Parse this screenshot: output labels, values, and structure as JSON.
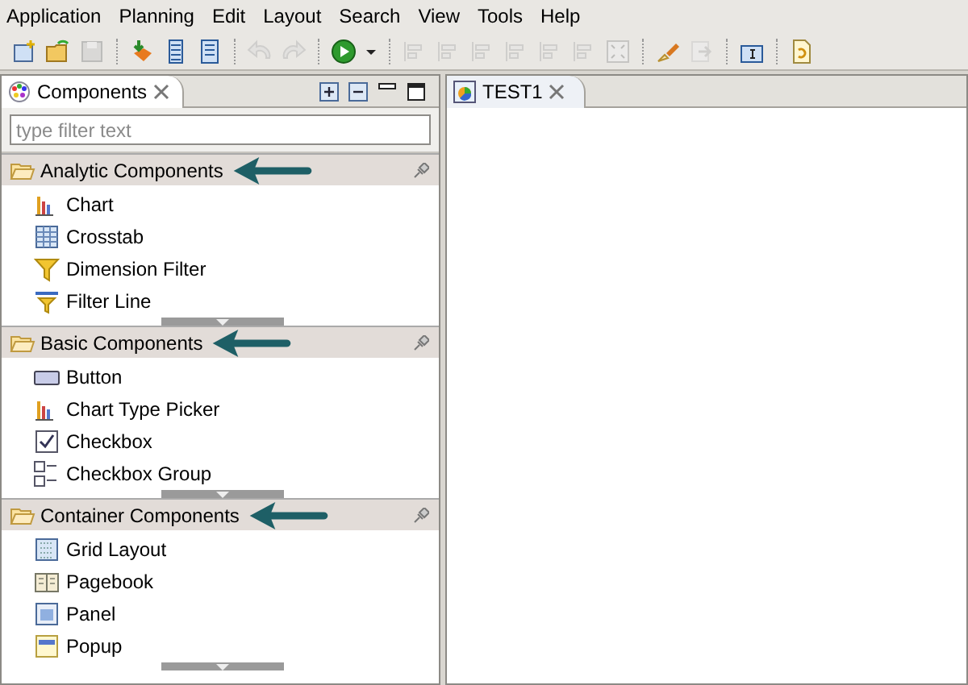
{
  "menu": [
    "Application",
    "Planning",
    "Edit",
    "Layout",
    "Search",
    "View",
    "Tools",
    "Help"
  ],
  "toolbar": [
    {
      "kind": "new",
      "disabled": false
    },
    {
      "kind": "open",
      "disabled": false
    },
    {
      "kind": "save",
      "disabled": true
    },
    {
      "kind": "sep"
    },
    {
      "kind": "import",
      "disabled": false
    },
    {
      "kind": "outline",
      "disabled": false
    },
    {
      "kind": "page",
      "disabled": false
    },
    {
      "kind": "sep"
    },
    {
      "kind": "undo",
      "disabled": true
    },
    {
      "kind": "redo",
      "disabled": true
    },
    {
      "kind": "sep"
    },
    {
      "kind": "run",
      "disabled": false
    },
    {
      "kind": "caret",
      "disabled": false
    },
    {
      "kind": "sep"
    },
    {
      "kind": "align",
      "disabled": true
    },
    {
      "kind": "align",
      "disabled": true
    },
    {
      "kind": "align",
      "disabled": true
    },
    {
      "kind": "align",
      "disabled": true
    },
    {
      "kind": "align",
      "disabled": true
    },
    {
      "kind": "align",
      "disabled": true
    },
    {
      "kind": "fit",
      "disabled": true
    },
    {
      "kind": "sep"
    },
    {
      "kind": "brush",
      "disabled": false
    },
    {
      "kind": "forward",
      "disabled": true
    },
    {
      "kind": "sep"
    },
    {
      "kind": "textfield",
      "disabled": false
    },
    {
      "kind": "sep"
    },
    {
      "kind": "script",
      "disabled": false
    }
  ],
  "components_view": {
    "title": "Components",
    "filter_placeholder": "type filter text",
    "sections": [
      {
        "title": "Analytic Components",
        "arrow": true,
        "items": [
          {
            "label": "Chart",
            "kind": "chart"
          },
          {
            "label": "Crosstab",
            "kind": "grid"
          },
          {
            "label": "Dimension Filter",
            "kind": "filter"
          },
          {
            "label": "Filter Line",
            "kind": "filterline"
          }
        ]
      },
      {
        "title": "Basic Components",
        "arrow": true,
        "items": [
          {
            "label": "Button",
            "kind": "button"
          },
          {
            "label": "Chart Type Picker",
            "kind": "chart"
          },
          {
            "label": "Checkbox",
            "kind": "checkbox"
          },
          {
            "label": "Checkbox Group",
            "kind": "checkgroup"
          }
        ]
      },
      {
        "title": "Container Components",
        "arrow": true,
        "items": [
          {
            "label": "Grid Layout",
            "kind": "gridlayout"
          },
          {
            "label": "Pagebook",
            "kind": "book"
          },
          {
            "label": "Panel",
            "kind": "panel"
          },
          {
            "label": "Popup",
            "kind": "popup"
          }
        ]
      }
    ]
  },
  "editor_tab": {
    "title": "TEST1"
  }
}
